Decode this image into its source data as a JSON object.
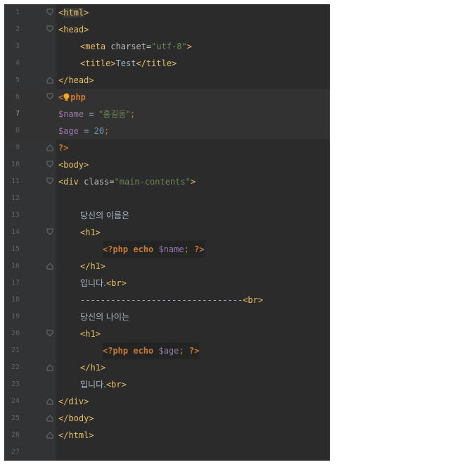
{
  "line_numbers": [
    "1",
    "2",
    "3",
    "4",
    "5",
    "6",
    "7",
    "8",
    "9",
    "10",
    "11",
    "12",
    "13",
    "14",
    "15",
    "16",
    "17",
    "18",
    "19",
    "20",
    "21",
    "22",
    "23",
    "24",
    "25",
    "26",
    "27"
  ],
  "code": {
    "l1_open": "<",
    "l1_tag": "html",
    "l1_close": ">",
    "l2": "<head>",
    "l3_open": "<meta ",
    "l3_attr": "charset",
    "l3_eq": "=",
    "l3_val": "\"utf-8\"",
    "l3_close": ">",
    "l4_open": "<title>",
    "l4_text": "Test",
    "l4_close": "</title>",
    "l5": "</head>",
    "l6_lt": "<",
    "l6_rest": "php",
    "l7_var": "$name",
    "l7_eq": " = ",
    "l7_str": "\"홍길동\"",
    "l7_semi": ";",
    "l8_var": "$age",
    "l8_eq": " = ",
    "l8_num": "20",
    "l8_semi": ";",
    "l9": "?>",
    "l10": "<body>",
    "l11_open": "<div ",
    "l11_attr": "class",
    "l11_eq": "=",
    "l11_val": "\"main-contents\"",
    "l11_close": ">",
    "l13": "당신의 이름은",
    "l14": "<h1>",
    "l15_open": "<?php",
    "l15_echo": " echo ",
    "l15_var": "$name",
    "l15_semi": "; ",
    "l15_close": "?>",
    "l16": "</h1>",
    "l17_text": "입니다.",
    "l17_tag": "<br>",
    "l18_dash": "--------------------------------",
    "l18_tag": "<br>",
    "l19": "당신의 나이는",
    "l20": "<h1>",
    "l21_open": "<?php",
    "l21_echo": " echo ",
    "l21_var": "$age",
    "l21_semi": "; ",
    "l21_close": "?>",
    "l22": "</h1>",
    "l23_text": "입니다.",
    "l23_tag": "<br>",
    "l24": "</div>",
    "l25": "</body>",
    "l26": "</html>"
  },
  "colors": {
    "background": "#2b2b2b",
    "gutter": "#313335",
    "tag": "#e8bf6a",
    "string": "#6a8759",
    "variable": "#9876aa",
    "number": "#6897bb",
    "keyword": "#cc7832"
  },
  "icons": [
    "fold-open-icon",
    "fold-close-icon",
    "lightbulb-icon"
  ]
}
